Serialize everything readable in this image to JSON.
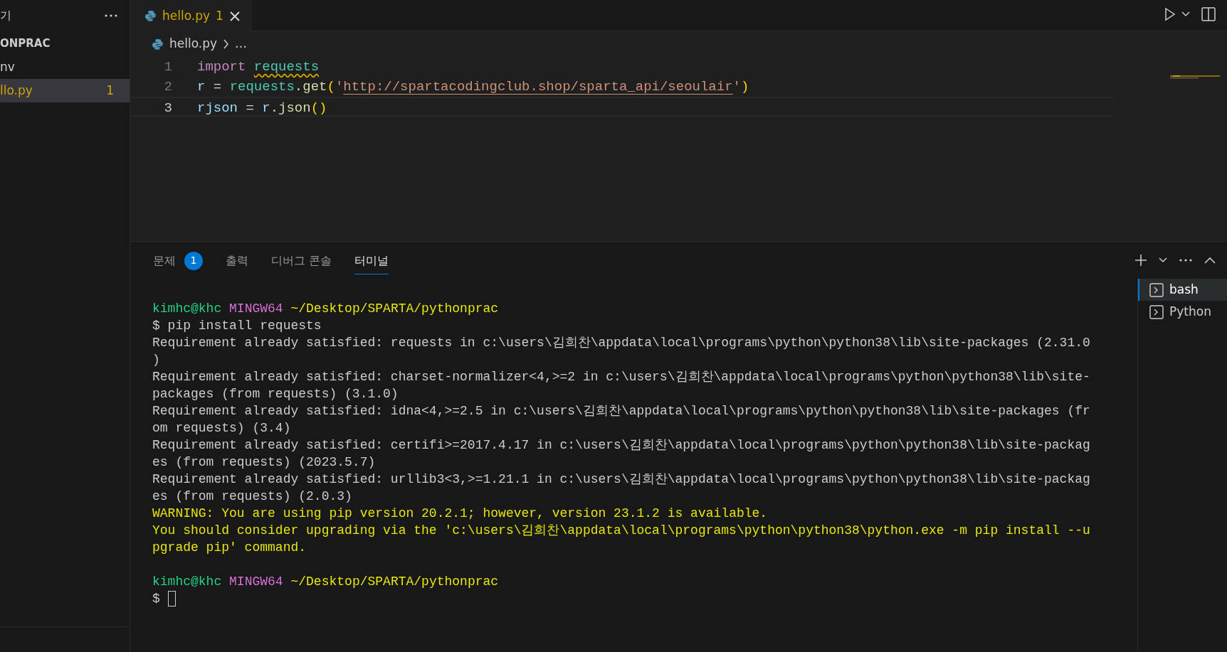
{
  "sidebar": {
    "title": "기",
    "items": [
      {
        "label": "ONPRAC",
        "kind": "folder",
        "selected": false
      },
      {
        "label": "nv",
        "kind": "file",
        "selected": false
      },
      {
        "label": "llo.py",
        "kind": "file",
        "selected": true,
        "badge": "1"
      }
    ]
  },
  "editor_tabs": [
    {
      "label": "hello.py",
      "problems": "1",
      "selected": true
    }
  ],
  "breadcrumb": {
    "file": "hello.py",
    "more": "…"
  },
  "code": [
    {
      "number": "1",
      "current": false,
      "tokens": [
        {
          "text": "import ",
          "kind": "keyword",
          "warning": false
        },
        {
          "text": "requests",
          "kind": "module",
          "warning": true
        }
      ]
    },
    {
      "number": "2",
      "current": false,
      "tokens": [
        {
          "text": "r",
          "kind": "variable",
          "warning": false
        },
        {
          "text": " = ",
          "kind": "plain",
          "warning": false
        },
        {
          "text": "requests",
          "kind": "module",
          "warning": false
        },
        {
          "text": ".",
          "kind": "plain",
          "warning": false
        },
        {
          "text": "get",
          "kind": "function",
          "warning": false
        },
        {
          "text": "(",
          "kind": "bracket",
          "warning": false
        },
        {
          "text": "'",
          "kind": "string",
          "warning": false
        },
        {
          "text": "http://spartacodingclub.shop/sparta_api/seoulair",
          "kind": "link",
          "warning": false
        },
        {
          "text": "'",
          "kind": "string",
          "warning": false
        },
        {
          "text": ")",
          "kind": "bracket",
          "warning": false
        }
      ]
    },
    {
      "number": "3",
      "current": true,
      "tokens": [
        {
          "text": "rjson",
          "kind": "variable",
          "warning": false
        },
        {
          "text": " = ",
          "kind": "plain",
          "warning": false
        },
        {
          "text": "r",
          "kind": "variable",
          "warning": false
        },
        {
          "text": ".",
          "kind": "plain",
          "warning": false
        },
        {
          "text": "json",
          "kind": "function",
          "warning": false
        },
        {
          "text": "()",
          "kind": "bracket",
          "warning": false
        }
      ]
    }
  ],
  "panel": {
    "tabs": [
      {
        "label": "문제",
        "badge": "1",
        "selected": false
      },
      {
        "label": "출력",
        "selected": false
      },
      {
        "label": "디버그 콘솔",
        "selected": false
      },
      {
        "label": "터미널",
        "selected": true
      }
    ],
    "terminal": [
      {
        "kind": "prompt",
        "user": "kimhc@khc",
        "host": "MINGW64",
        "path": "~/Desktop/SPARTA/pythonprac"
      },
      {
        "kind": "output",
        "text": "$ pip install requests"
      },
      {
        "kind": "output",
        "text": "Requirement already satisfied: requests in c:\\users\\김희찬\\appdata\\local\\programs\\python\\python38\\lib\\site-packages (2.31.0"
      },
      {
        "kind": "output",
        "text": ")"
      },
      {
        "kind": "output",
        "text": "Requirement already satisfied: charset-normalizer<4,>=2 in c:\\users\\김희찬\\appdata\\local\\programs\\python\\python38\\lib\\site-"
      },
      {
        "kind": "output",
        "text": "packages (from requests) (3.1.0)"
      },
      {
        "kind": "output",
        "text": "Requirement already satisfied: idna<4,>=2.5 in c:\\users\\김희찬\\appdata\\local\\programs\\python\\python38\\lib\\site-packages (fr"
      },
      {
        "kind": "output",
        "text": "om requests) (3.4)"
      },
      {
        "kind": "output",
        "text": "Requirement already satisfied: certifi>=2017.4.17 in c:\\users\\김희찬\\appdata\\local\\programs\\python\\python38\\lib\\site-packag"
      },
      {
        "kind": "output",
        "text": "es (from requests) (2023.5.7)"
      },
      {
        "kind": "output",
        "text": "Requirement already satisfied: urllib3<3,>=1.21.1 in c:\\users\\김희찬\\appdata\\local\\programs\\python\\python38\\lib\\site-packag"
      },
      {
        "kind": "output",
        "text": "es (from requests) (2.0.3)"
      },
      {
        "kind": "warning",
        "text": "WARNING: You are using pip version 20.2.1; however, version 23.1.2 is available."
      },
      {
        "kind": "warning",
        "text": "You should consider upgrading via the 'c:\\users\\김희찬\\appdata\\local\\programs\\python\\python38\\python.exe -m pip install --u"
      },
      {
        "kind": "warning",
        "text": "pgrade pip' command."
      },
      {
        "kind": "blank"
      },
      {
        "kind": "prompt",
        "user": "kimhc@khc",
        "host": "MINGW64",
        "path": "~/Desktop/SPARTA/pythonprac"
      },
      {
        "kind": "input",
        "text": "$"
      }
    ],
    "terminals": [
      {
        "label": "bash",
        "selected": true
      },
      {
        "label": "Python",
        "selected": false
      }
    ]
  }
}
